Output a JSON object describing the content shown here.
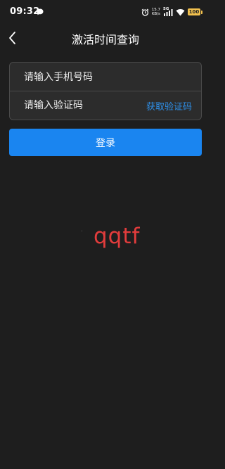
{
  "status_bar": {
    "time": "09:32",
    "net_speed_value": "15.7",
    "net_speed_unit": "KB/s",
    "network_label": "5G",
    "battery": "100"
  },
  "header": {
    "title": "激活时间查询"
  },
  "form": {
    "phone_placeholder": "请输入手机号码",
    "code_placeholder": "请输入验证码",
    "get_code_label": "获取验证码"
  },
  "login_button": {
    "label": "登录"
  },
  "overlay_text": "qqtf",
  "colors": {
    "background": "#1e1e1e",
    "accent": "#1a85f0",
    "link": "#2e8fe8",
    "overlay_text": "#e23c3c",
    "battery": "#f2c14e"
  },
  "icons": {
    "chat": "chat-bubble-icon",
    "alarm": "alarm-clock-icon",
    "signal": "signal-bars-icon",
    "wifi": "wifi-icon",
    "battery": "battery-icon",
    "back": "chevron-left-icon"
  }
}
